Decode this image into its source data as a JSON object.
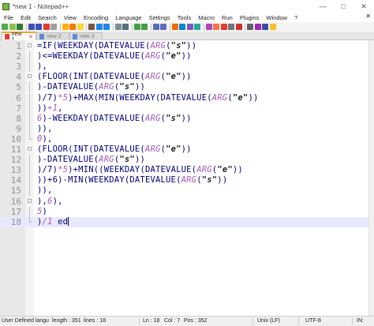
{
  "window": {
    "title": "*new 1 - Notepad++",
    "controls": [
      "—",
      "□",
      "✕"
    ]
  },
  "menu": {
    "items": [
      "File",
      "Edit",
      "Search",
      "View",
      "Encoding",
      "Language",
      "Settings",
      "Tools",
      "Macro",
      "Run",
      "Plugins",
      "Window",
      "?"
    ],
    "close": "✕"
  },
  "toolbar": {
    "icon_colors": [
      "#4caf50",
      "#8bc34a",
      "#2e7d32",
      "#3f51b5",
      "#3f51b5",
      "#e53935",
      "#9e9e9e",
      "#ffb300",
      "#f57c00",
      "#fdd835",
      "#795548",
      "#1e88e5",
      "#1e88e5",
      "#78909c",
      "#546e7a",
      "#43a047",
      "#43a047",
      "#5c6bc0",
      "#5c6bc0",
      "#ef6c00",
      "#0288d1",
      "#7e57c2",
      "#26a69a",
      "#ab47bc",
      "#ff7043",
      "#e53935",
      "#757575",
      "#d32f2f",
      "#616161",
      "#9c27b0",
      "#3949ab",
      "#fbc02d"
    ]
  },
  "tabs": [
    {
      "label": "new 1",
      "active": true
    },
    {
      "label": "new 2",
      "active": false
    },
    {
      "label": "new 3",
      "active": false
    }
  ],
  "editor": {
    "lines": [
      {
        "n": "1",
        "tokens": [
          [
            "p",
            "=IF(WEEKDAY(DATEVALUE("
          ],
          [
            "arg",
            "ARG"
          ],
          [
            "p",
            "("
          ],
          [
            "str",
            "\"s\""
          ],
          [
            "p",
            "))"
          ]
        ]
      },
      {
        "n": "2",
        "tokens": [
          [
            "p",
            ")<=WEEKDAY(DATEVALUE("
          ],
          [
            "arg",
            "ARG"
          ],
          [
            "p",
            "("
          ],
          [
            "str",
            "\"e\""
          ],
          [
            "p",
            "))"
          ]
        ]
      },
      {
        "n": "3",
        "tokens": [
          [
            "p",
            "),"
          ]
        ]
      },
      {
        "n": "4",
        "tokens": [
          [
            "p",
            "(FLOOR(INT(DATEVALUE("
          ],
          [
            "arg",
            "ARG"
          ],
          [
            "p",
            "("
          ],
          [
            "str",
            "\"e\""
          ],
          [
            "p",
            "))"
          ]
        ]
      },
      {
        "n": "5",
        "tokens": [
          [
            "p",
            ")-DATEVALUE("
          ],
          [
            "arg",
            "ARG"
          ],
          [
            "p",
            "("
          ],
          [
            "str",
            "\"s\""
          ],
          [
            "p",
            "))"
          ]
        ]
      },
      {
        "n": "6",
        "tokens": [
          [
            "p",
            ")/7)"
          ],
          [
            "arg",
            "*5"
          ],
          [
            "p",
            ")+MAX(MIN(WEEKDAY(DATEVALUE("
          ],
          [
            "arg",
            "ARG"
          ],
          [
            "p",
            "("
          ],
          [
            "str",
            "\"e\""
          ],
          [
            "p",
            "))"
          ]
        ]
      },
      {
        "n": "7",
        "tokens": [
          [
            "p",
            "))"
          ],
          [
            "arg",
            "+1"
          ],
          [
            "p",
            ","
          ]
        ]
      },
      {
        "n": "8",
        "tokens": [
          [
            "arg",
            "6"
          ],
          [
            "p",
            ")-WEEKDAY(DATEVALUE("
          ],
          [
            "arg",
            "ARG"
          ],
          [
            "p",
            "("
          ],
          [
            "str",
            "\"s\""
          ],
          [
            "p",
            "))"
          ]
        ]
      },
      {
        "n": "9",
        "tokens": [
          [
            "p",
            "))"
          ],
          [
            "p",
            ","
          ]
        ]
      },
      {
        "n": "10",
        "tokens": [
          [
            "arg",
            "0"
          ],
          [
            "p",
            "),"
          ]
        ]
      },
      {
        "n": "11",
        "tokens": [
          [
            "p",
            "(FLOOR(INT(DATEVALUE("
          ],
          [
            "arg",
            "ARG"
          ],
          [
            "p",
            "("
          ],
          [
            "str",
            "\"e\""
          ],
          [
            "p",
            "))"
          ]
        ]
      },
      {
        "n": "12",
        "tokens": [
          [
            "p",
            ")-DATEVALUE("
          ],
          [
            "arg",
            "ARG"
          ],
          [
            "p",
            "("
          ],
          [
            "str",
            "\"s\""
          ],
          [
            "p",
            "))"
          ]
        ]
      },
      {
        "n": "13",
        "tokens": [
          [
            "p",
            ")/7)"
          ],
          [
            "arg",
            "*5"
          ],
          [
            "p",
            ")+MIN((WEEKDAY(DATEVALUE("
          ],
          [
            "arg",
            "ARG"
          ],
          [
            "p",
            "("
          ],
          [
            "str",
            "\"e\""
          ],
          [
            "p",
            "))"
          ]
        ]
      },
      {
        "n": "14",
        "tokens": [
          [
            "p",
            "))+6)-MIN(WEEKDAY(DATEVALUE("
          ],
          [
            "arg",
            "ARG"
          ],
          [
            "p",
            "("
          ],
          [
            "str",
            "\"s\""
          ],
          [
            "p",
            "))"
          ]
        ]
      },
      {
        "n": "15",
        "tokens": [
          [
            "p",
            "))"
          ],
          [
            "p",
            ","
          ]
        ]
      },
      {
        "n": "16",
        "tokens": [
          [
            "p",
            ")"
          ],
          [
            "p",
            ","
          ],
          [
            "arg",
            "6"
          ],
          [
            "p",
            ")"
          ],
          [
            "p",
            ","
          ]
        ]
      },
      {
        "n": "17",
        "tokens": [
          [
            "arg",
            "5"
          ],
          [
            "p",
            ")"
          ]
        ]
      },
      {
        "n": "18",
        "tokens": [
          [
            "p",
            ")"
          ],
          [
            "arg",
            "/1"
          ],
          [
            "p",
            " ed"
          ]
        ]
      }
    ],
    "current_line": 18,
    "fold_markers": [
      1,
      4,
      11,
      16
    ],
    "fold_continuations": [
      2,
      3,
      5,
      6,
      7,
      8,
      9,
      12,
      13,
      14,
      15,
      17
    ],
    "fold_ends": [
      10,
      18
    ]
  },
  "status": {
    "language": "User Defined langu",
    "length": "length : 351",
    "lines": "lines : 18",
    "ln": "Ln : 18",
    "col": "Col : 7",
    "pos": "Pos : 352",
    "eol": "Unix (LF)",
    "encoding": "UTF-8",
    "mode": "IN:"
  }
}
